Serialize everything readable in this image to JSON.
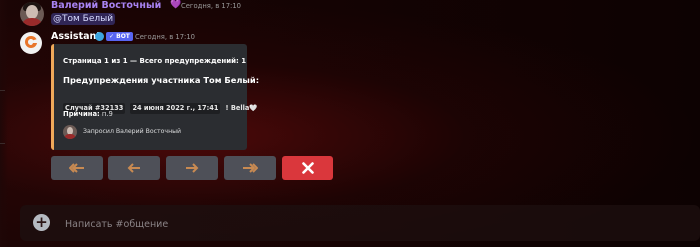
{
  "message1": {
    "author": "Валерий Восточный",
    "heart": "💜",
    "timestamp": "Сегодня, в 17:10",
    "mention": "@Том Белый"
  },
  "message2": {
    "author": "Assistant",
    "bot_badge": "✓ BOT",
    "timestamp": "Сегодня, в 17:10",
    "embed": {
      "accent_color": "#f0a95a",
      "page_info": "Страница 1 из 1 — Всего предупреждений: 1",
      "title": "Предупреждения участника Том Белый:",
      "case_label": "Случай",
      "case_id": "#32133",
      "date": "24 июня 2022 г., 17:41",
      "issuer": "! Bella🤍",
      "reason_label": "Причина:",
      "reason_value": "п.9",
      "footer": "Запросил Валерий Восточный"
    }
  },
  "buttons": {
    "first_icon": "double-arrow-left-icon",
    "prev_icon": "arrow-left-icon",
    "next_icon": "arrow-right-icon",
    "last_icon": "double-arrow-right-icon",
    "close_icon": "close-icon",
    "nav_color": "#4e5058",
    "arrow_color": "#c88a52",
    "close_color": "#da373c"
  },
  "composer": {
    "placeholder": "Написать #общение",
    "plus_symbol": "+"
  }
}
